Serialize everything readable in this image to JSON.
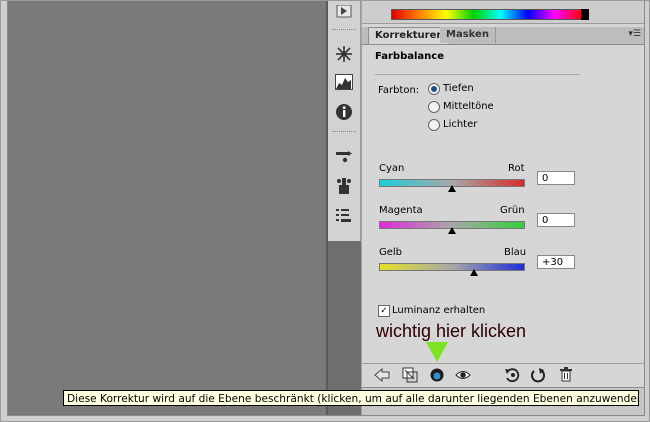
{
  "panel": {
    "tabs": [
      {
        "label": "Korrekturen"
      },
      {
        "label": "Masken"
      }
    ],
    "title": "Farbbalance",
    "tone": {
      "label": "Farbton:",
      "options": [
        {
          "label": "Tiefen",
          "selected": true
        },
        {
          "label": "Mitteltöne",
          "selected": false
        },
        {
          "label": "Lichter",
          "selected": false
        }
      ]
    },
    "sliders": [
      {
        "left": "Cyan",
        "right": "Rot",
        "value": "0",
        "position": 0.5,
        "colors": [
          "#1ecdd9",
          "#d92a2a"
        ]
      },
      {
        "left": "Magenta",
        "right": "Grün",
        "value": "0",
        "position": 0.5,
        "colors": [
          "#e02ad8",
          "#31d13a"
        ]
      },
      {
        "left": "Gelb",
        "right": "Blau",
        "value": "+30",
        "position": 0.65,
        "colors": [
          "#e4e02a",
          "#1d2fdb"
        ]
      }
    ],
    "luminance": {
      "label": "Luminanz erhalten",
      "checked": true
    }
  },
  "annotation": {
    "text": "wichtig hier klicken",
    "color": "#2b0000",
    "pointer_color": "#7be321"
  },
  "tooltip": "Diese Korrektur wird auf die Ebene beschränkt (klicken, um auf alle darunter liegenden Ebenen anzuwenden)",
  "icons": {
    "sidebar": [
      "play-icon",
      "snowflake-icon",
      "histogram-icon",
      "info-icon",
      "brush-preset-icon",
      "clone-source-icon",
      "tool-preset-icon"
    ],
    "bottom": [
      "back-arrow-icon",
      "expand-view-icon",
      "clip-to-layer-icon",
      "visibility-eye-icon",
      "previous-state-icon",
      "reset-icon",
      "delete-icon"
    ]
  }
}
